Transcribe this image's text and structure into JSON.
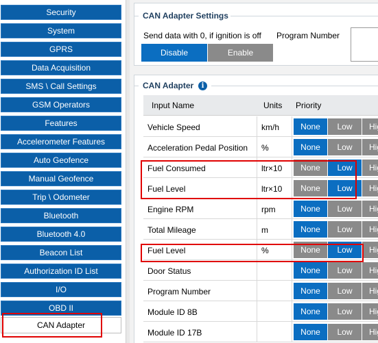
{
  "sidebar": {
    "items": [
      "Security",
      "System",
      "GPRS",
      "Data Acquisition",
      "SMS \\ Call Settings",
      "GSM Operators",
      "Features",
      "Accelerometer Features",
      "Auto Geofence",
      "Manual Geofence",
      "Trip \\ Odometer",
      "Bluetooth",
      "Bluetooth 4.0",
      "Beacon List",
      "Authorization ID List",
      "I/O",
      "OBD II",
      "CAN Adapter"
    ],
    "active": "CAN Adapter"
  },
  "settings_panel": {
    "title": "CAN Adapter Settings",
    "send_label": "Send data with 0, if ignition is off",
    "disable_label": "Disable",
    "enable_label": "Enable",
    "selected": "Disable",
    "program_number_label": "Program Number",
    "program_number_value": ""
  },
  "adapter_panel": {
    "title": "CAN Adapter",
    "info_icon": "info-icon",
    "columns": {
      "name": "Input Name",
      "units": "Units",
      "priority": "Priority"
    },
    "priority_labels": {
      "none": "None",
      "low": "Low",
      "high": "High"
    },
    "rows": [
      {
        "name": "Vehicle Speed",
        "units": "km/h",
        "priority": "None"
      },
      {
        "name": "Acceleration Pedal Position",
        "units": "%",
        "priority": "None"
      },
      {
        "name": "Fuel Consumed",
        "units": "ltr×10",
        "priority": "Low"
      },
      {
        "name": "Fuel Level",
        "units": "ltr×10",
        "priority": "Low"
      },
      {
        "name": "Engine RPM",
        "units": "rpm",
        "priority": "None"
      },
      {
        "name": "Total Mileage",
        "units": "m",
        "priority": "None"
      },
      {
        "name": "Fuel Level",
        "units": "%",
        "priority": "Low"
      },
      {
        "name": "Door Status",
        "units": "",
        "priority": "None"
      },
      {
        "name": "Program Number",
        "units": "",
        "priority": "None"
      },
      {
        "name": "Module ID 8B",
        "units": "",
        "priority": "None"
      },
      {
        "name": "Module ID 17B",
        "units": "",
        "priority": "None"
      }
    ]
  },
  "colors": {
    "nav": "#0b5fa8",
    "selected": "#0b6ec1",
    "unselected": "#8a8a8a",
    "highlight": "#e00000"
  }
}
